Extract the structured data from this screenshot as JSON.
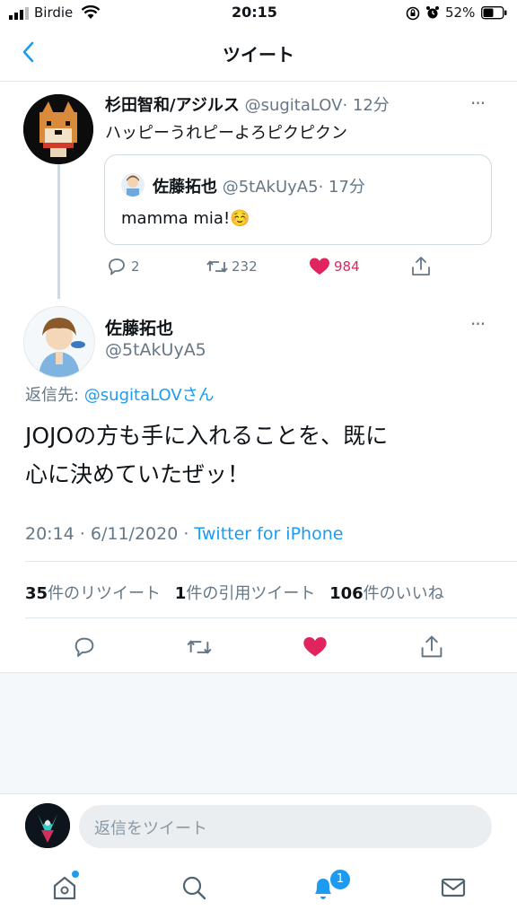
{
  "status_bar": {
    "carrier": "Birdie",
    "time": "20:15",
    "battery": "52%",
    "signal_bars": 4,
    "battery_level": 0.52
  },
  "nav": {
    "title": "ツイート",
    "back_icon": "chevron-left-icon"
  },
  "parent_tweet": {
    "name": "杉田智和/アジルス",
    "handle": "@sugitaLOV",
    "time": "· 12分",
    "text": "ハッピーうれピーよろピクピクン",
    "quoted": {
      "name": "佐藤拓也",
      "handle": "@5tAkUyA5",
      "time": "· 17分",
      "text": "mamma mia!☺️"
    },
    "actions": {
      "replies": "2",
      "retweets": "232",
      "likes": "984"
    }
  },
  "main_tweet": {
    "name": "佐藤拓也",
    "handle": "@5tAkUyA5",
    "reply_prefix": "返信先: ",
    "reply_to": "@sugitaLOVさん",
    "text_line1": "JOJOの方も手に入れることを、既に",
    "text_line2": "心に決めていたぜッ！",
    "timestamp": "20:14 · 6/11/2020 · ",
    "source": "Twitter for iPhone",
    "stats": {
      "retweets_count": "35",
      "retweets_label": "件のリツイート",
      "quotes_count": "1",
      "quotes_label": "件の引用ツイート",
      "likes_count": "106",
      "likes_label": "件のいいね"
    }
  },
  "reply_bar": {
    "placeholder": "返信をツイート"
  },
  "tab_bar": {
    "notification_badge": "1"
  },
  "colors": {
    "accent": "#1d9bf0",
    "like": "#e0245e",
    "muted": "#657786"
  }
}
